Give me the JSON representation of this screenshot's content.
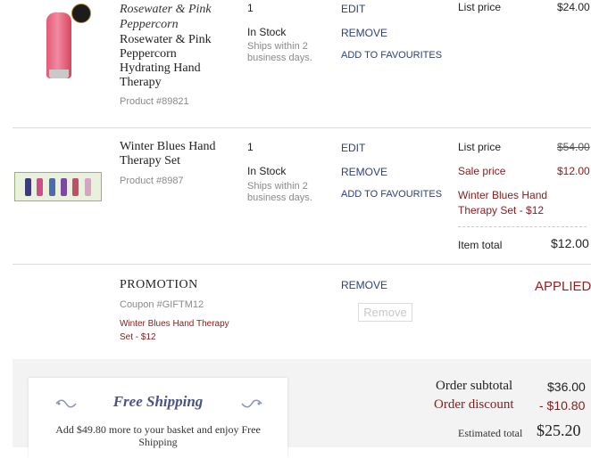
{
  "items": [
    {
      "name_italic": "Rosewater & Pink Peppercorn",
      "name": "Rosewater & Pink Peppercorn Hydrating Hand Therapy",
      "product_number": "Product #89821",
      "stock": "In Stock",
      "ships": "Ships within 2 business days.",
      "actions": {
        "edit": "EDIT",
        "remove": "REMOVE",
        "favourites": "ADD TO FAVOURITES"
      },
      "list_price_label": "List price",
      "list_price": "$24.00",
      "image_icon": "hand-cream-tube-icon"
    },
    {
      "name": "Winter Blues Hand Therapy Set",
      "product_number": "Product #8987",
      "quantity": "1",
      "stock": "In Stock",
      "ships": "Ships within 2 business days.",
      "actions": {
        "edit": "EDIT",
        "remove": "REMOVE",
        "favourites": "ADD TO FAVOURITES"
      },
      "list_price_label": "List price",
      "list_price": "$54.00",
      "sale_price_label": "Sale price",
      "sale_price": "$12.00",
      "promo_text": "Winter Blues Hand Therapy Set - $12",
      "item_total_label": "Item total",
      "item_total": "$12.00",
      "image_icon": "gift-set-icon"
    }
  ],
  "item1_quantity": "1",
  "promotion": {
    "title": "PROMOTION",
    "coupon": "Coupon #GIFTM12",
    "description": "Winter Blues Hand Therapy Set - $12",
    "remove_label": "REMOVE",
    "remove_button_label": "Remove",
    "status": "APPLIED"
  },
  "shipping_box": {
    "title": "Free Shipping",
    "message": "Add $49.80 more to your basket and enjoy Free Shipping"
  },
  "summary": {
    "subtotal_label": "Order subtotal",
    "subtotal": "$36.00",
    "discount_label": "Order discount",
    "discount": "- $10.80",
    "estimated_label": "Estimated total",
    "estimated": "$25.20"
  },
  "colors": {
    "link": "#2f3f78",
    "discount_red": "#8b1a1a",
    "divider": "#dcdcdc"
  }
}
